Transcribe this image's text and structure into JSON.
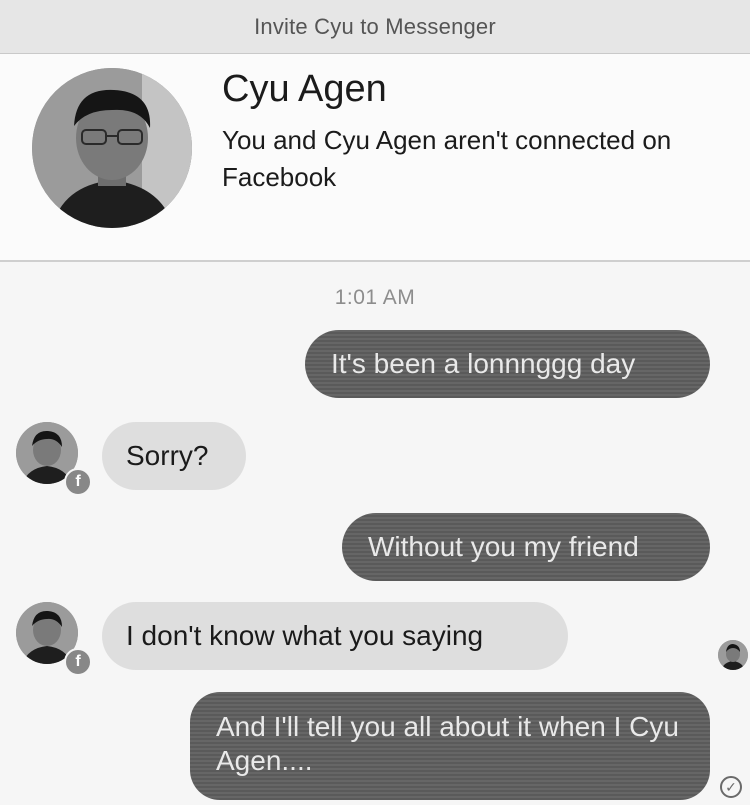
{
  "invite_bar": {
    "text": "Invite Cyu to Messenger"
  },
  "profile": {
    "name": "Cyu Agen",
    "status": "You and Cyu Agen aren't connected on Facebook",
    "avatar_icon": "user-photo-icon"
  },
  "thread": {
    "timestamp": "1:01 AM",
    "messages": [
      {
        "direction": "outgoing",
        "text": "It's been a lonnnggg day"
      },
      {
        "direction": "incoming",
        "text": "Sorry?"
      },
      {
        "direction": "outgoing",
        "text": "Without you my friend"
      },
      {
        "direction": "incoming",
        "text": "I don't know what you saying"
      },
      {
        "direction": "outgoing",
        "text": "And I'll tell you all about it when I Cyu Agen...."
      }
    ]
  },
  "icons": {
    "facebook_badge": "f",
    "sent_check": "✓"
  },
  "colors": {
    "outgoing_bubble": "#5a5a5a",
    "incoming_bubble": "#dedede",
    "invite_bar": "#e6e6e6"
  }
}
